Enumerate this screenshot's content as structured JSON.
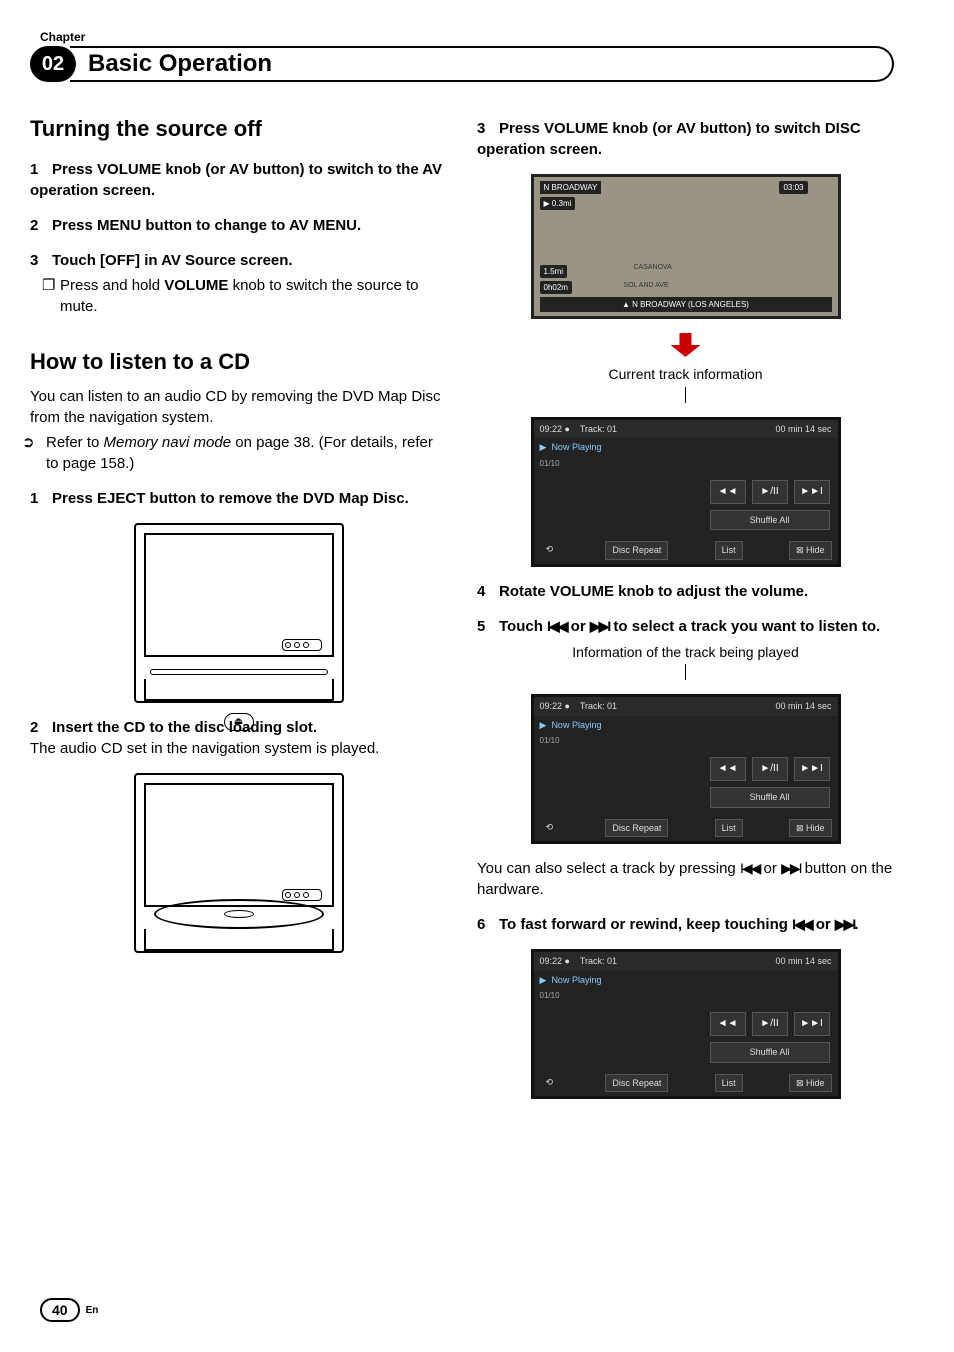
{
  "header": {
    "chapter_label": "Chapter",
    "chapter_num": "02",
    "title": "Basic Operation"
  },
  "left": {
    "h_turning": "Turning the source off",
    "t1": "1",
    "t1_text": "Press VOLUME knob (or AV button) to switch to the AV operation screen.",
    "t2": "2",
    "t2_text": "Press MENU button to change to AV MENU.",
    "t3": "3",
    "t3_text": "Touch [OFF] in AV Source screen.",
    "t3_bullet_a": "Press and hold ",
    "t3_bullet_b": "VOLUME",
    "t3_bullet_c": " knob to switch the source to mute.",
    "h_listen": "How to listen to a CD",
    "listen_intro": "You can listen to an audio CD by removing the DVD Map Disc from the navigation system.",
    "ref_a": "Refer to ",
    "ref_b": "Memory navi mode",
    "ref_c": " on page 38. (For details, refer to page 158.)",
    "l1": "1",
    "l1_text": "Press EJECT button to remove the DVD Map Disc.",
    "l2": "2",
    "l2_text": "Insert the CD to the disc loading slot.",
    "l2_follow": "The audio CD set in the navigation system is played."
  },
  "right": {
    "r3": "3",
    "r3_text": "Press VOLUME knob (or AV button) to switch DISC operation screen.",
    "map": {
      "top": "N BROADWAY",
      "time": "03:03",
      "dist1": "0.3mi",
      "dist2": "1.5mi",
      "eta": "0h02m",
      "road1": "CASANOVA",
      "road2": "SOL AND AVE",
      "bottom": "N BROADWAY (LOS ANGELES)"
    },
    "caption1": "Current track information",
    "player": {
      "time": "09:22",
      "track": "Track: 01",
      "duration": "00 min   14 sec",
      "now": "Now Playing",
      "count": "01/10",
      "prev": "◄◄",
      "play": "►/II",
      "next": "►►I",
      "shuffle": "Shuffle All",
      "repeat": "Disc Repeat",
      "list": "List",
      "hide": "⊠ Hide"
    },
    "r4": "4",
    "r4_text": "Rotate VOLUME knob to adjust the volume.",
    "r5": "5",
    "r5_text_a": "Touch ",
    "r5_text_b": " or ",
    "r5_text_c": " to select a track you want to listen to.",
    "caption2": "Information of the track being played",
    "after5_a": "You can also select a track by pressing ",
    "after5_b": " or ",
    "after5_c": " button on the hardware.",
    "r6": "6",
    "r6_text_a": "To fast forward or rewind, keep touching ",
    "r6_text_b": " or ",
    "r6_text_c": "."
  },
  "icons": {
    "prev": "I◀◀",
    "next": "▶▶I"
  },
  "footer": {
    "page": "40",
    "lang": "En"
  }
}
